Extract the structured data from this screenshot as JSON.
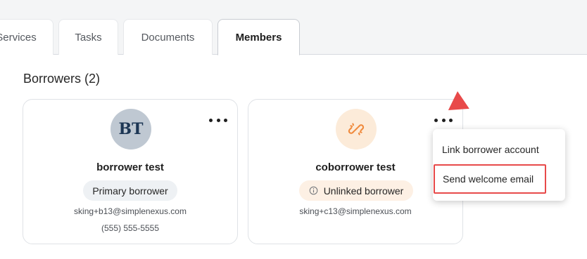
{
  "tabs": [
    {
      "label": "Services"
    },
    {
      "label": "Tasks"
    },
    {
      "label": "Documents"
    },
    {
      "label": "Members",
      "active": true
    }
  ],
  "section": {
    "title": "Borrowers (2)"
  },
  "borrowers": [
    {
      "avatar_text": "BT",
      "name": "borrower test",
      "role": "Primary borrower",
      "email": "sking+b13@simplenexus.com",
      "phone": "(555) 555-5555"
    },
    {
      "avatar_icon": "broken-link-icon",
      "name": "coborrower test",
      "role": "Unlinked borrower",
      "role_icon": "info-icon",
      "email": "sking+c13@simplenexus.com"
    }
  ],
  "menu": {
    "items": [
      {
        "label": "Link borrower account"
      },
      {
        "label": "Send welcome email",
        "highlighted": true
      }
    ]
  },
  "colors": {
    "accent_red": "#e84a4a",
    "avatar_bt_bg": "#bfc8d2",
    "avatar_link_bg": "#fcebd9",
    "link_icon_orange": "#f08a3c"
  }
}
